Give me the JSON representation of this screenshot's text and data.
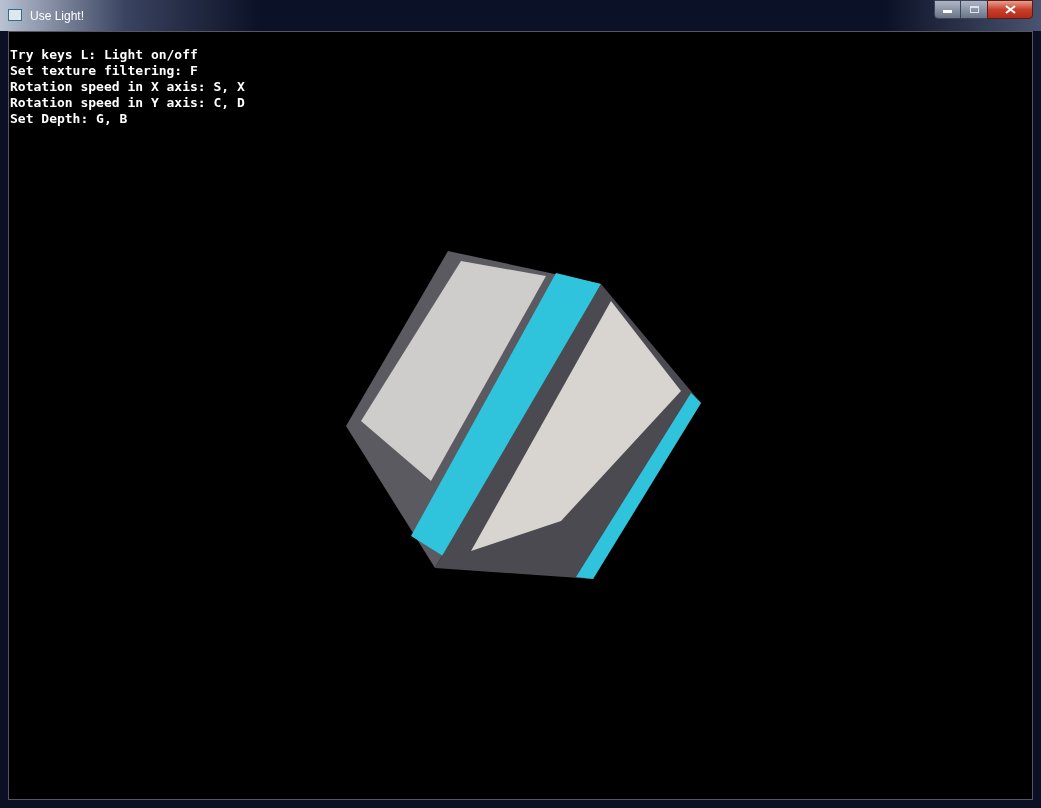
{
  "window": {
    "title": "Use Light!"
  },
  "help_lines": [
    "Try keys L: Light on/off",
    "Set texture filtering: F",
    "Rotation speed in X axis: S, X",
    "Rotation speed in Y axis: C, D",
    "Set Depth: G, B"
  ]
}
